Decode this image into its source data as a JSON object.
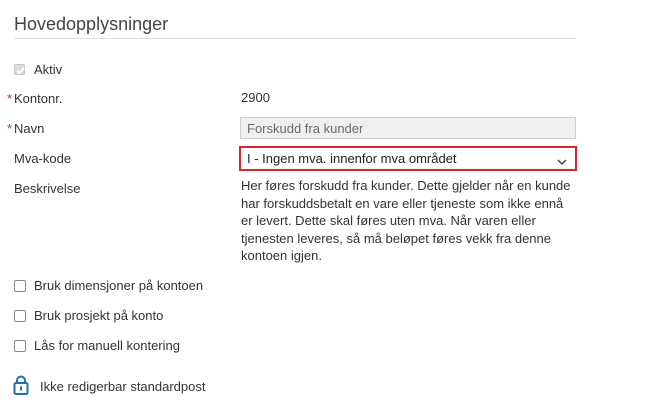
{
  "section": {
    "title": "Hovedopplysninger"
  },
  "fields": {
    "aktiv_label": "Aktiv",
    "kontonr_required": "*",
    "kontonr_label": "Kontonr.",
    "kontonr_value": "2900",
    "navn_required": "*",
    "navn_label": "Navn",
    "navn_value": "Forskudd fra kunder",
    "mva_label": "Mva-kode",
    "mva_value": "I - Ingen mva. innenfor mva området",
    "beskrivelse_label": "Beskrivelse",
    "beskrivelse_value": "Her føres forskudd fra kunder. Dette gjelder når en kunde har forskuddsbetalt en vare eller tjeneste som ikke ennå er levert. Dette skal føres uten mva. Når varen eller tjenesten leveres, så må beløpet føres vekk fra denne kontoen igjen."
  },
  "options": {
    "dimensjoner_label": "Bruk dimensjoner på kontoen",
    "prosjekt_label": "Bruk prosjekt på konto",
    "laas_label": "Lås for manuell kontering"
  },
  "footer": {
    "locked_label": "Ikke redigerbar standardpost"
  },
  "colors": {
    "highlight": "#d9252b",
    "lock": "#1f6fb2",
    "required": "#c0392b"
  },
  "icons": {
    "lock": "lock-icon",
    "chevron": "chevron-down-icon",
    "check": "check-icon"
  }
}
